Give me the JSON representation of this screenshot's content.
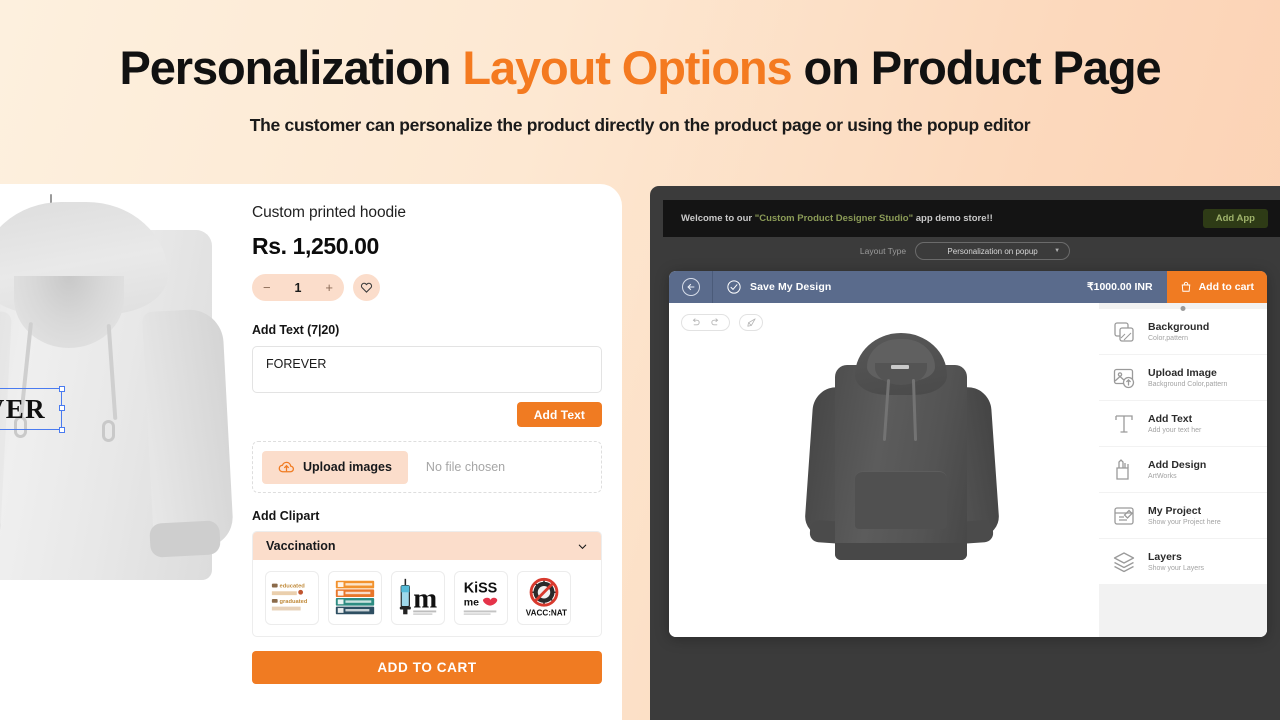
{
  "header": {
    "title_part1": "Personalization ",
    "title_accent": "Layout Options",
    "title_part2": " on Product Page",
    "subtitle": "The customer can personalize the product directly on the product page or using the popup editor",
    "accent_color": "#F47A20"
  },
  "product": {
    "title": "Custom printed hoodie",
    "price": "Rs. 1,250.00",
    "quantity": "1",
    "minus": "−",
    "plus": "+",
    "canvas_text": "REVER",
    "add_text_label": "Add Text (7|20)",
    "text_value": "FOREVER",
    "add_text_button": "Add Text",
    "upload_button": "Upload images",
    "no_file": "No file chosen",
    "clipart_label": "Add Clipart",
    "clipart_selected": "Vaccination",
    "cliparts": [
      {
        "name": "educated-vaccinated-graduated-clipart",
        "alt": "educated graduated"
      },
      {
        "name": "vaccination-checklist-clipart",
        "alt": "vaccination checklist"
      },
      {
        "name": "syringe-m-clipart",
        "alt": "syringe m"
      },
      {
        "name": "kiss-me-vaccinated-clipart",
        "alt": "kiss me"
      },
      {
        "name": "virus-crossed-vaccinated-clipart",
        "alt": "vaccinated"
      }
    ],
    "add_to_cart": "ADD TO CART",
    "accent_color": "#F07B22",
    "pill_color": "#FBDDCB"
  },
  "store": {
    "welcome_prefix": "Welcome to our ",
    "welcome_highlight": "\"Custom Product Designer Studio\"",
    "welcome_suffix": " app demo store!!",
    "add_app_button": "Add App",
    "layout_type_label": "Layout Type",
    "layout_type_value": "Personalization on popup"
  },
  "editor": {
    "save_label": "Save My Design",
    "price": "₹1000.00 INR",
    "add_to_cart": "Add to cart",
    "tools": [
      "undo-icon",
      "redo-icon",
      "brush-icon"
    ],
    "sidebar": [
      {
        "title": "Background",
        "subtitle": "Color,pattern",
        "icon": "background-layers-icon"
      },
      {
        "title": "Upload Image",
        "subtitle": "Background Color,pattern",
        "icon": "upload-image-icon"
      },
      {
        "title": "Add Text",
        "subtitle": "Add your text her",
        "icon": "text-t-icon"
      },
      {
        "title": "Add Design",
        "subtitle": "ArtWorks",
        "icon": "art-supplies-icon"
      },
      {
        "title": "My Project",
        "subtitle": "Show your Project here",
        "icon": "my-project-icon"
      },
      {
        "title": "Layers",
        "subtitle": "Show your Layers",
        "icon": "layers-stack-icon"
      }
    ]
  }
}
